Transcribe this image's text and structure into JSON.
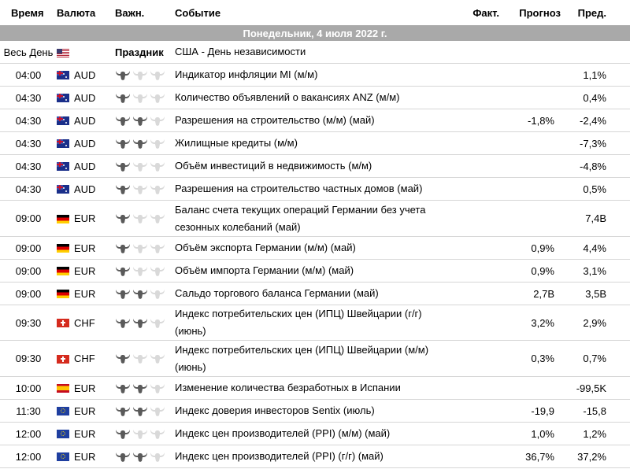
{
  "header": {
    "time": "Время",
    "currency": "Валюта",
    "importance": "Важн.",
    "event": "Событие",
    "actual": "Факт.",
    "forecast": "Прогноз",
    "previous": "Пред."
  },
  "date_label": "Понедельник, 4 июля 2022 г.",
  "holiday": {
    "time": "Весь День",
    "flag": "us",
    "label": "Праздник",
    "event": "США - День независимости"
  },
  "rows": [
    {
      "time": "04:00",
      "flag": "aud",
      "currency": "AUD",
      "importance": 1,
      "event": "Индикатор инфляции MI (м/м)",
      "actual": "",
      "forecast": "",
      "previous": "1,1%"
    },
    {
      "time": "04:30",
      "flag": "aud",
      "currency": "AUD",
      "importance": 1,
      "event": "Количество объявлений о вакансиях ANZ (м/м)",
      "actual": "",
      "forecast": "",
      "previous": "0,4%"
    },
    {
      "time": "04:30",
      "flag": "aud",
      "currency": "AUD",
      "importance": 2,
      "event": "Разрешения на строительство (м/м) (май)",
      "actual": "",
      "forecast": "-1,8%",
      "previous": "-2,4%"
    },
    {
      "time": "04:30",
      "flag": "aud",
      "currency": "AUD",
      "importance": 2,
      "event": "Жилищные кредиты (м/м)",
      "actual": "",
      "forecast": "",
      "previous": "-7,3%"
    },
    {
      "time": "04:30",
      "flag": "aud",
      "currency": "AUD",
      "importance": 1,
      "event": "Объём инвестиций в недвижимость (м/м)",
      "actual": "",
      "forecast": "",
      "previous": "-4,8%"
    },
    {
      "time": "04:30",
      "flag": "aud",
      "currency": "AUD",
      "importance": 1,
      "event": "Разрешения на строительство частных домов (май)",
      "actual": "",
      "forecast": "",
      "previous": "0,5%"
    },
    {
      "time": "09:00",
      "flag": "eur-de",
      "currency": "EUR",
      "importance": 1,
      "event": "Баланс счета текущих операций Германии без учета сезонных колебаний (май)",
      "actual": "",
      "forecast": "",
      "previous": "7,4B",
      "tall": true
    },
    {
      "time": "09:00",
      "flag": "eur-de",
      "currency": "EUR",
      "importance": 1,
      "event": "Объём экспорта Германии (м/м) (май)",
      "actual": "",
      "forecast": "0,9%",
      "previous": "4,4%"
    },
    {
      "time": "09:00",
      "flag": "eur-de",
      "currency": "EUR",
      "importance": 1,
      "event": "Объём импорта Германии (м/м) (май)",
      "actual": "",
      "forecast": "0,9%",
      "previous": "3,1%"
    },
    {
      "time": "09:00",
      "flag": "eur-de",
      "currency": "EUR",
      "importance": 2,
      "event": "Сальдо торгового баланса Германии (май)",
      "actual": "",
      "forecast": "2,7B",
      "previous": "3,5B"
    },
    {
      "time": "09:30",
      "flag": "chf",
      "currency": "CHF",
      "importance": 2,
      "event": "Индекс потребительских цен (ИПЦ) Швейцарии (г/г) (июнь)",
      "actual": "",
      "forecast": "3,2%",
      "previous": "2,9%"
    },
    {
      "time": "09:30",
      "flag": "chf",
      "currency": "CHF",
      "importance": 1,
      "event": "Индекс потребительских цен (ИПЦ) Швейцарии (м/м) (июнь)",
      "actual": "",
      "forecast": "0,3%",
      "previous": "0,7%",
      "tall": true
    },
    {
      "time": "10:00",
      "flag": "es",
      "currency": "EUR",
      "importance": 2,
      "event": "Изменение количества безработных в Испании",
      "actual": "",
      "forecast": "",
      "previous": "-99,5K"
    },
    {
      "time": "11:30",
      "flag": "eu",
      "currency": "EUR",
      "importance": 2,
      "event": "Индекс доверия инвесторов Sentix (июль)",
      "actual": "",
      "forecast": "-19,9",
      "previous": "-15,8"
    },
    {
      "time": "12:00",
      "flag": "eu",
      "currency": "EUR",
      "importance": 1,
      "event": "Индекс цен производителей (PPI) (м/м) (май)",
      "actual": "",
      "forecast": "1,0%",
      "previous": "1,2%"
    },
    {
      "time": "12:00",
      "flag": "eu",
      "currency": "EUR",
      "importance": 2,
      "event": "Индекс цен производителей (PPI) (г/г) (май)",
      "actual": "",
      "forecast": "36,7%",
      "previous": "37,2%"
    }
  ],
  "colors": {
    "bull_active": "#5a5a5a",
    "bull_inactive": "#d9d9d9",
    "date_bar": "#a9a9a9",
    "row_border": "#d6d6d6"
  },
  "icons": {
    "importance": "bull-icon"
  }
}
